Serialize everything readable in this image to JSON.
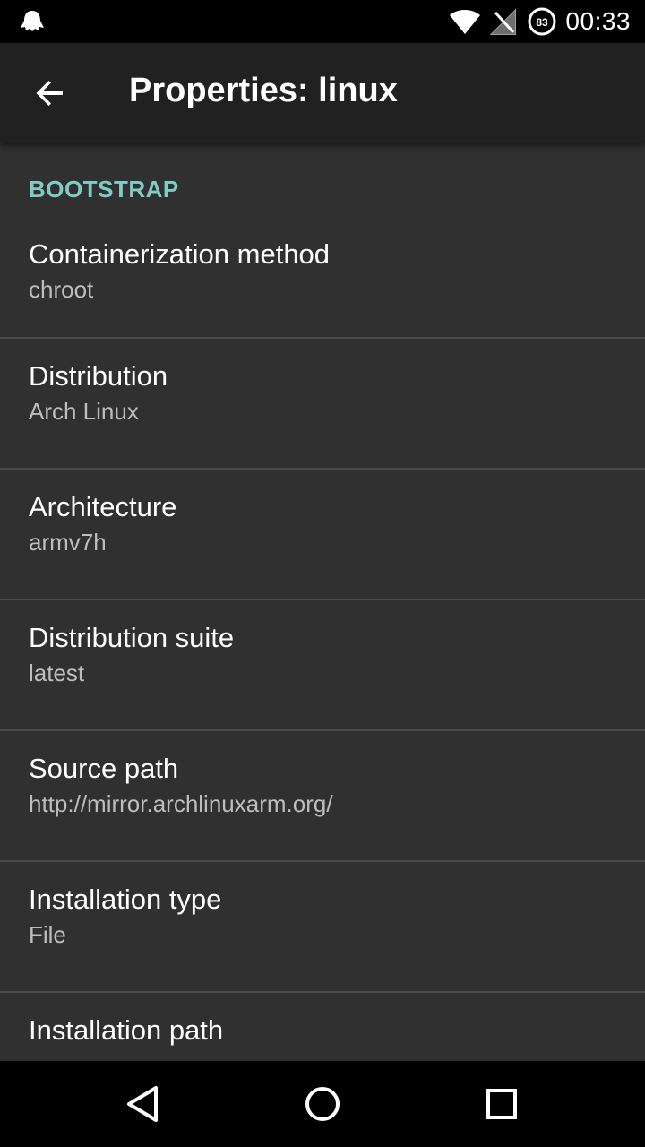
{
  "status_bar": {
    "time": "00:33",
    "battery_level": "83",
    "icons": [
      "ghost-notification-icon",
      "wifi-icon",
      "no-signal-icon",
      "battery-icon"
    ]
  },
  "app_bar": {
    "title": "Properties: linux",
    "back_icon": "arrow-back-icon"
  },
  "category": {
    "label": "BOOTSTRAP",
    "accent_color": "#80cbc4"
  },
  "preferences": [
    {
      "title": "Containerization method",
      "summary": "chroot"
    },
    {
      "title": "Distribution",
      "summary": "Arch Linux"
    },
    {
      "title": "Architecture",
      "summary": "armv7h"
    },
    {
      "title": "Distribution suite",
      "summary": "latest"
    },
    {
      "title": "Source path",
      "summary": "http://mirror.archlinuxarm.org/"
    },
    {
      "title": "Installation type",
      "summary": "File"
    },
    {
      "title": "Installation path",
      "summary": ""
    }
  ],
  "nav_bar": {
    "icons": [
      "back-triangle-icon",
      "home-circle-icon",
      "recents-square-icon"
    ]
  }
}
